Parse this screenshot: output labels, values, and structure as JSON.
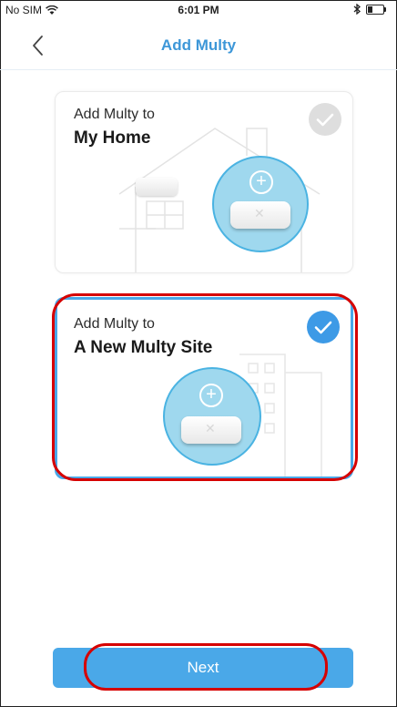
{
  "status_bar": {
    "carrier": "No SIM",
    "time": "6:01 PM",
    "battery_level": 0.3
  },
  "nav": {
    "title": "Add Multy",
    "back_icon": "chevron-left-icon"
  },
  "options": [
    {
      "line1": "Add Multy to",
      "line2": "My Home",
      "selected": false
    },
    {
      "line1": "Add Multy to",
      "line2": "A New Multy Site",
      "selected": true
    }
  ],
  "next_button": {
    "label": "Next"
  },
  "colors": {
    "accent": "#3d97d8",
    "button": "#4aa8e8",
    "annotation": "#d60000"
  }
}
